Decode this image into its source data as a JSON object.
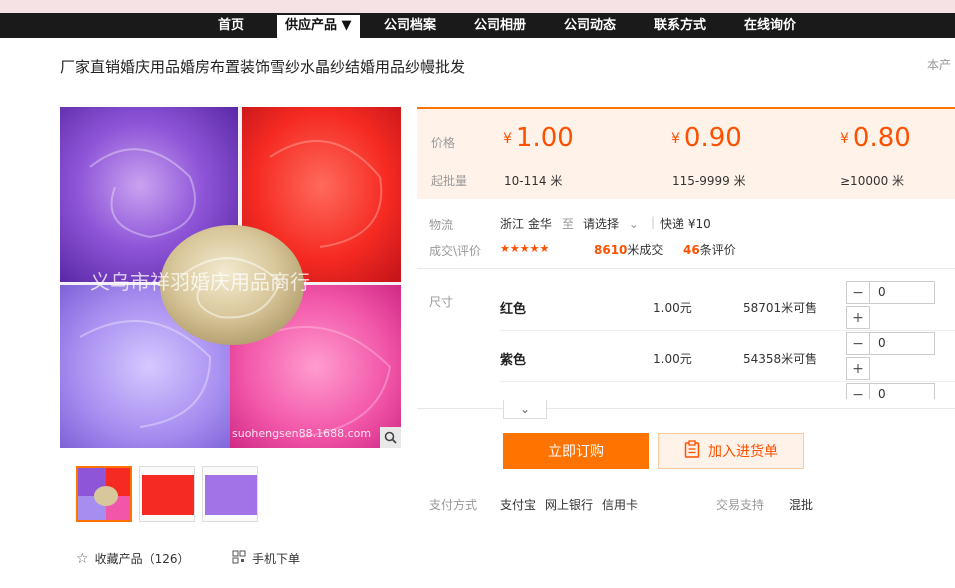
{
  "nav": {
    "items": [
      "首页",
      "供应产品 ▼",
      "公司档案",
      "公司相册",
      "公司动态",
      "联系方式",
      "在线询价"
    ]
  },
  "product": {
    "title": "厂家直销婚庆用品婚房布置装饰雪纱水晶纱结婚用品纱幔批发",
    "corner_text": "本产",
    "watermark_cn": "义乌市祥羽婚庆用品商行",
    "watermark_url": "suohengsen88.1688.com"
  },
  "price": {
    "price_label": "价格",
    "moq_label": "起批量",
    "currency": "¥",
    "tiers": [
      {
        "price": "1.00",
        "range": "10-114 米"
      },
      {
        "price": "0.90",
        "range": "115-9999 米"
      },
      {
        "price": "0.80",
        "range": "≥10000 米"
      }
    ]
  },
  "logistics": {
    "label": "物流",
    "origin": "浙江 金华",
    "to": "至",
    "select": "请选择",
    "express": "快递 ¥10"
  },
  "deals": {
    "label": "成交\\评价",
    "rating": 4.5,
    "deal_count": "8610",
    "deal_suffix": "米成交",
    "review_count": "46",
    "review_suffix": "条评价"
  },
  "sku": {
    "label": "尺寸",
    "rows": [
      {
        "name": "红色",
        "price": "1.00元",
        "stock": "58701米可售",
        "qty": "0"
      },
      {
        "name": "紫色",
        "price": "1.00元",
        "stock": "54358米可售",
        "qty": "0"
      },
      {
        "qty": "0"
      }
    ]
  },
  "actions": {
    "buy": "立即订购",
    "cart": "加入进货单"
  },
  "payment": {
    "label": "支付方式",
    "methods": [
      "支付宝",
      "网上银行",
      "信用卡"
    ],
    "trade_label": "交易支持",
    "trade_value": "混批"
  },
  "bottom": {
    "favorite": "收藏产品（126）",
    "mobile": "手机下单"
  },
  "colors": {
    "accent": "#ff7300",
    "price": "#ff5000",
    "nav_bg": "#1a1a1a"
  }
}
